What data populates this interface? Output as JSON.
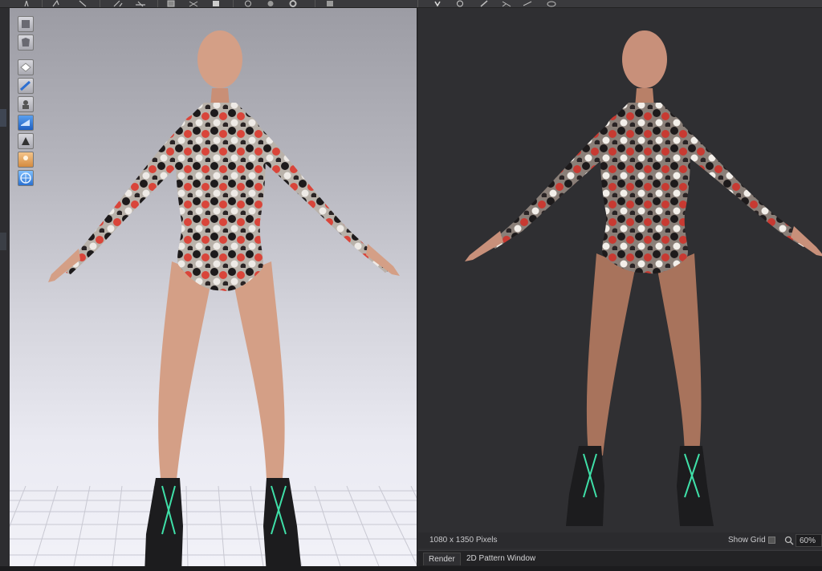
{
  "toolbar": {
    "icons": [
      "pose-icon",
      "move-icon",
      "select-icon",
      "cut-icon",
      "sew-icon",
      "pin-icon",
      "grid-icon",
      "layer-icon",
      "circle-icon",
      "sphere-icon",
      "cloth-icon",
      "render-icon",
      "arrow-down-icon",
      "globe-icon",
      "brush-icon",
      "transform-icon",
      "ring-icon"
    ]
  },
  "palette": {
    "icons": [
      "display-avatar-icon",
      "display-garment-icon",
      "avatar-pose-icon",
      "edit-avatar-icon",
      "measure-icon",
      "texture-icon",
      "shading-icon",
      "skin-icon",
      "environment-icon"
    ]
  },
  "status": {
    "size_text": "1080 x 1350 Pixels",
    "show_grid_label": "Show Grid",
    "zoom_value": "60%"
  },
  "tabs": {
    "render": "Render",
    "pattern": "2D Pattern Window"
  },
  "colors": {
    "skin": "#d49f86",
    "suit_base": "#b9b2aa",
    "suit_red": "#d9453a",
    "suit_dark": "#1d1a1b",
    "lace": "#3fe0a8",
    "boot": "#1c1c1e"
  }
}
